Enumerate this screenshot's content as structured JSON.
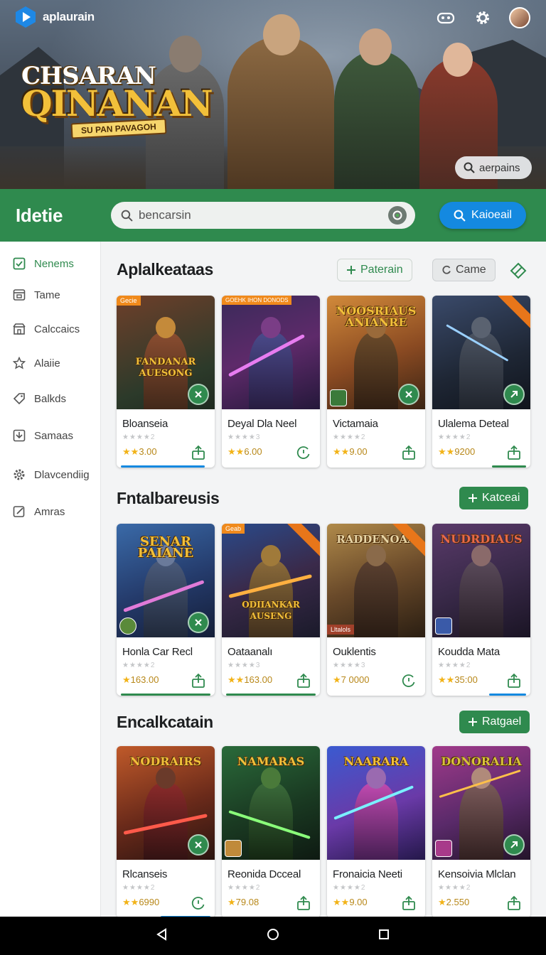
{
  "app": {
    "name": "aplaurain"
  },
  "hero": {
    "logo_line1": "CHSARAN",
    "logo_line2": "QINANAN",
    "logo_banner": "SU PAN PAVAGOH",
    "search_label": "aerpains"
  },
  "topbar": {
    "title": "Idetie",
    "search_placeholder": "bencarsin",
    "button_label": "Kaioeail"
  },
  "sidebar": {
    "items": [
      {
        "label": "Nenems",
        "icon": "check-square-icon",
        "active": true
      },
      {
        "label": "Tame",
        "icon": "window-icon"
      },
      {
        "label": "Calccaics",
        "icon": "store-icon"
      },
      {
        "label": "Alaiie",
        "icon": "star-icon"
      },
      {
        "label": "Balkds",
        "icon": "tag-icon"
      },
      {
        "label": "Samaas",
        "icon": "download-box-icon"
      },
      {
        "label": "Dlavcendiig",
        "icon": "gear-icon"
      },
      {
        "label": "Amras",
        "icon": "edit-icon"
      }
    ]
  },
  "sections": [
    {
      "title": "Aplalkeataas",
      "buttons": [
        {
          "label": "Paterain",
          "icon": "plus-icon"
        },
        {
          "label": "Came",
          "icon": "refresh-icon"
        }
      ],
      "cards": [
        {
          "name": "Bloanseia",
          "stars": "★★★★2",
          "price": "3.00",
          "tag": "Gecie",
          "art_title": "FANDANAR AUESONG",
          "action": "share-icon"
        },
        {
          "name": "Deyal Dla Neel",
          "stars": "★★★★3",
          "price": "6.00",
          "tag": "GOEHK IHON DONODS",
          "art_title": "",
          "action": "refresh-icon"
        },
        {
          "name": "Victamaia",
          "stars": "★★★★2",
          "price": "9.00",
          "tag": "",
          "art_title": "NOOSRIAUS ANIANRE",
          "action": "share-icon"
        },
        {
          "name": "Ulalema Deteal",
          "stars": "★★★★2",
          "price": "9200",
          "tag": "",
          "art_title": "",
          "action": "share-icon"
        }
      ]
    },
    {
      "title": "Fntalbareusis",
      "buttons": [
        {
          "label": "Katceai",
          "icon": "plus-icon"
        }
      ],
      "cards": [
        {
          "name": "Honla Car Recl",
          "stars": "★★★★2",
          "price": "163.00",
          "tag": "",
          "art_title": "SENAR PAIANE",
          "action": "share-icon"
        },
        {
          "name": "Oataanalı",
          "stars": "★★★★3",
          "price": "163.00",
          "tag": "Geab",
          "art_title": "ODIIANKAR AUSENG",
          "action": "share-icon"
        },
        {
          "name": "Ouklentis",
          "stars": "★★★★3",
          "price": "7 0000",
          "tag": "Lltalols",
          "art_title": "RADDENOAA",
          "action": "refresh-icon"
        },
        {
          "name": "Koudda Mata",
          "stars": "★★★★2",
          "price": "35:00",
          "tag": "",
          "art_title": "NUDRDIAUS",
          "action": "share-icon"
        }
      ]
    },
    {
      "title": "Encalkcatain",
      "buttons": [
        {
          "label": "Ratgael",
          "icon": "plus-icon"
        }
      ],
      "cards": [
        {
          "name": "Rlcanseis",
          "stars": "★★★★2",
          "price": "6990",
          "tag": "",
          "art_title": "NODRAIRS",
          "action": "refresh-icon"
        },
        {
          "name": "Reonida Dcceal",
          "stars": "★★★★2",
          "price": "79.08",
          "tag": "",
          "art_title": "NAMARAS",
          "action": "share-icon"
        },
        {
          "name": "Fronaicia Neeti",
          "stars": "★★★★2",
          "price": "9.00",
          "tag": "",
          "art_title": "NAARARA",
          "action": "share-icon"
        },
        {
          "name": "Kensoivia Mlclan",
          "stars": "★★★★2",
          "price": "2.550",
          "tag": "",
          "art_title": "DONORALIA",
          "action": "share-icon"
        }
      ]
    }
  ],
  "colors": {
    "brand_green": "#2f8a4e",
    "accent_blue": "#1489e0",
    "price_gold": "#b8881a"
  }
}
